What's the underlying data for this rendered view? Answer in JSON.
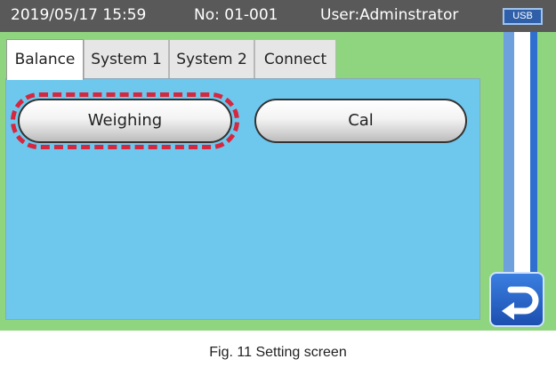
{
  "status_bar": {
    "datetime": "2019/05/17 15:59",
    "number": "No: 01-001",
    "user": "User:Adminstrator",
    "usb_badge": "USB"
  },
  "tabs": [
    {
      "label": "Balance",
      "active": true
    },
    {
      "label": "System 1",
      "active": false
    },
    {
      "label": "System 2",
      "active": false
    },
    {
      "label": "Connect",
      "active": false
    }
  ],
  "buttons": {
    "weighing": "Weighing",
    "cal": "Cal"
  },
  "back_button": {
    "icon": "return-arrow-icon"
  },
  "caption": "Fig. 11    Setting screen",
  "colors": {
    "status_bar": "#595959",
    "panel": "#6ec8ee",
    "background": "#8fd47e",
    "highlight": "#d7263d",
    "accent_blue": "#2f6fcf"
  }
}
